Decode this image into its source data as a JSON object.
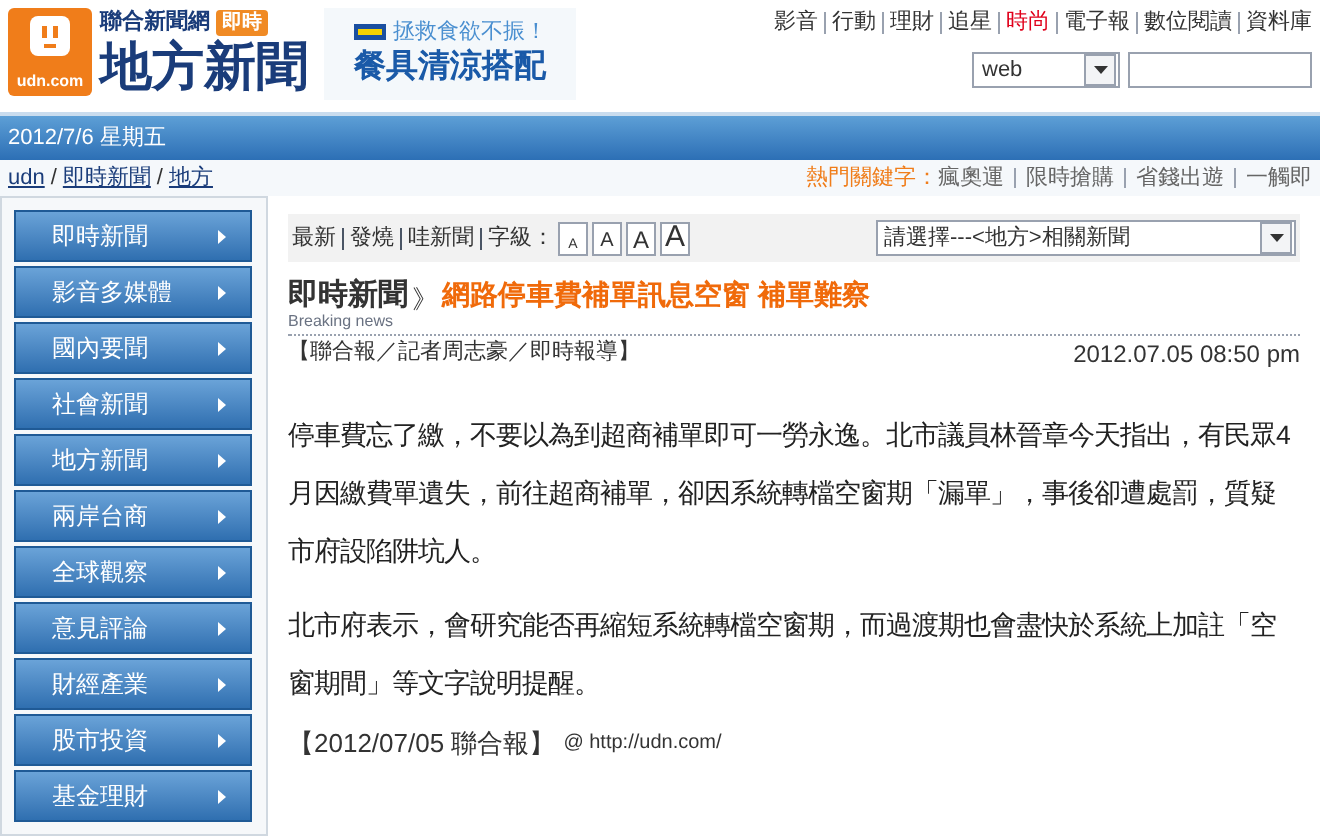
{
  "header": {
    "logo_text": "udn.com",
    "site_name": "聯合新聞網",
    "badge": "即時",
    "section_title": "地方新聞",
    "ad": {
      "line_1": "拯救食欲不振！",
      "line_2": "餐具清涼搭配"
    },
    "top_links": [
      {
        "label": "影音",
        "highlighted": false
      },
      {
        "label": "行動",
        "highlighted": false
      },
      {
        "label": "理財",
        "highlighted": false
      },
      {
        "label": "追星",
        "highlighted": false
      },
      {
        "label": "時尚",
        "highlighted": true
      },
      {
        "label": "電子報",
        "highlighted": false
      },
      {
        "label": "數位閱讀",
        "highlighted": false
      },
      {
        "label": "資料庫",
        "highlighted": false
      }
    ],
    "search_scope": "web"
  },
  "date_bar": "2012/7/6 星期五",
  "breadcrumb": {
    "separator": "/",
    "items": [
      "udn",
      "即時新聞",
      "地方"
    ]
  },
  "hot_keywords": {
    "label": "熱門關鍵字：",
    "items": [
      "瘋奧運",
      "限時搶購",
      "省錢出遊",
      "一觸即"
    ]
  },
  "sidebar": {
    "items": [
      "即時新聞",
      "影音多媒體",
      "國內要聞",
      "社會新聞",
      "地方新聞",
      "兩岸台商",
      "全球觀察",
      "意見評論",
      "財經產業",
      "股市投資",
      "基金理財"
    ]
  },
  "toolbar": {
    "links": [
      "最新",
      "發燒",
      "哇新聞"
    ],
    "font_size_label": "字級：",
    "font_sizes": [
      {
        "label": "A",
        "selected": false
      },
      {
        "label": "A",
        "selected": false
      },
      {
        "label": "A",
        "selected": false
      },
      {
        "label": "A",
        "selected": false
      }
    ],
    "related_select": "請選擇---<地方>相關新聞"
  },
  "article": {
    "section": "即時新聞",
    "section_en": "Breaking news",
    "title_marker": "》",
    "title": "網路停車費補單訊息空窗 補單難察",
    "byline": "【聯合報／記者周志豪／即時報導】",
    "timestamp": "2012.07.05 08:50 pm",
    "paragraphs": [
      "停車費忘了繳，不要以為到超商補單即可一勞永逸。北市議員林晉章今天指出，有民眾4月因繳費單遺失，前往超商補單，卻因系統轉檔空窗期「漏單」，事後卻遭處罰，質疑市府設陷阱坑人。",
      "北市府表示，會研究能否再縮短系統轉檔空窗期，而過渡期也會盡快於系統上加註「空窗期間」等文字說明提醒。"
    ],
    "source": "【2012/07/05 聯合報】",
    "source_link": "@ http://udn.com/"
  }
}
